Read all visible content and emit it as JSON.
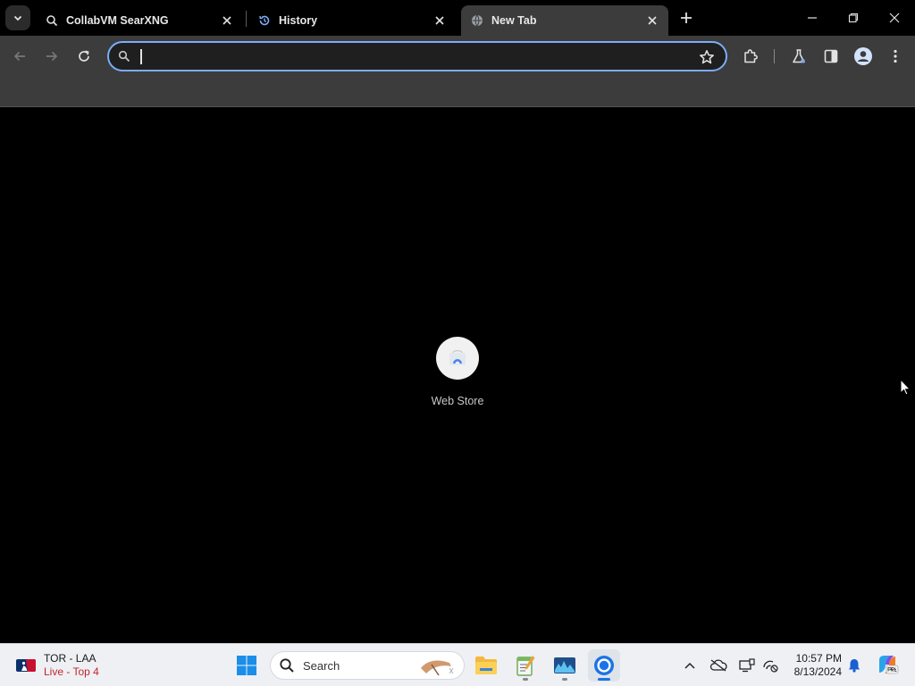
{
  "browser": {
    "tabs": [
      {
        "title": "CollabVM SearXNG",
        "favicon": "searxng-icon",
        "active": false
      },
      {
        "title": "History",
        "favicon": "history-icon",
        "active": false
      },
      {
        "title": "New Tab",
        "favicon": "globe-icon",
        "active": true
      }
    ],
    "omnibox": {
      "value": "",
      "placeholder": ""
    },
    "shortcuts": [
      {
        "label": "Web Store",
        "icon": "web-store-icon"
      }
    ]
  },
  "taskbar": {
    "widget": {
      "line1": "TOR - LAA",
      "line2": "Live - Top 4"
    },
    "search_label": "Search",
    "clock": {
      "time": "10:57 PM",
      "date": "8/13/2024"
    },
    "apps": [
      "windows-start-icon",
      "file-explorer-icon",
      "notepad-icon",
      "photos-icon",
      "chrome-icon"
    ],
    "tray": [
      "chevron-up-icon",
      "onedrive-offline-icon",
      "display-icon",
      "network-icon",
      "notification-bell-icon",
      "copilot-icon"
    ]
  },
  "colors": {
    "accent": "#7cacf8",
    "toolbar": "#3c3c3c",
    "live": "#c0262d",
    "taskbar": "#eef0f4"
  }
}
